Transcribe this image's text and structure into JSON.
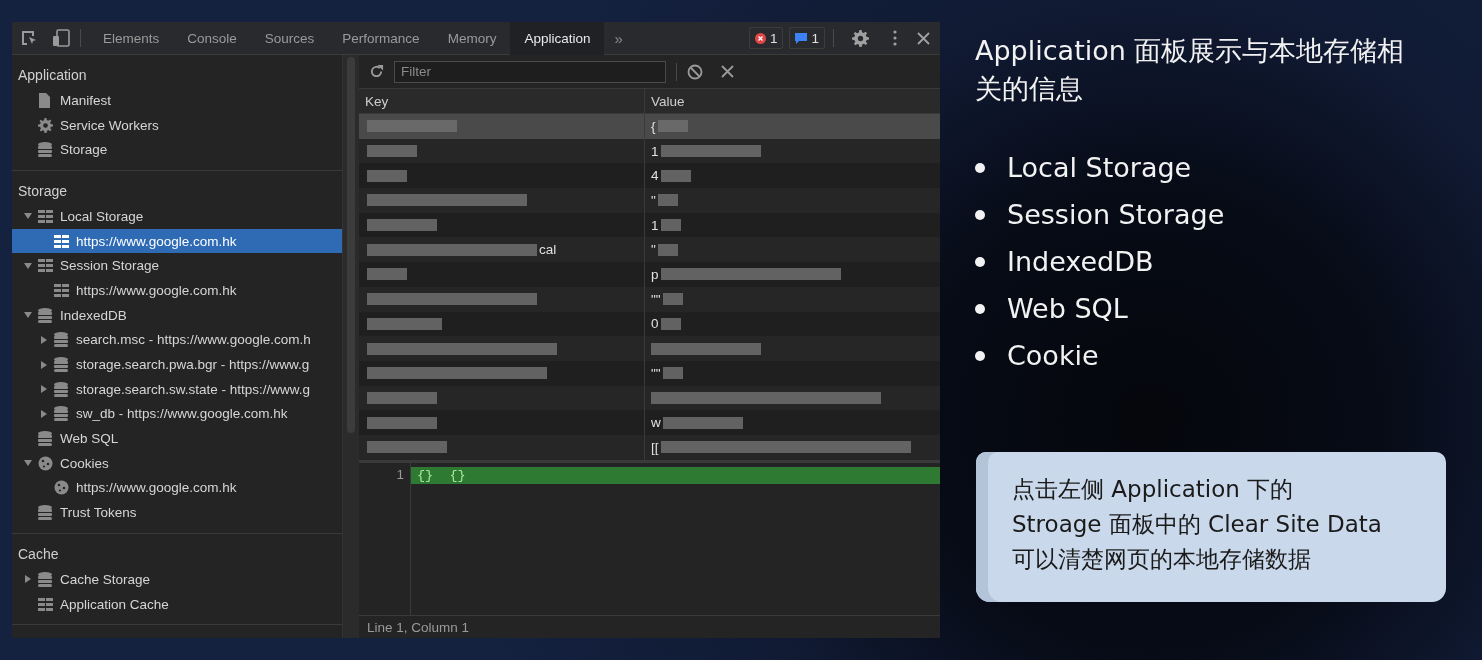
{
  "devtools": {
    "tabs": [
      {
        "label": "Elements",
        "selected": false
      },
      {
        "label": "Console",
        "selected": false
      },
      {
        "label": "Sources",
        "selected": false
      },
      {
        "label": "Performance",
        "selected": false
      },
      {
        "label": "Memory",
        "selected": false
      },
      {
        "label": "Application",
        "selected": true
      }
    ],
    "more_tabs": "»",
    "error_count": "1",
    "message_count": "1",
    "sidebar": [
      {
        "title": "Application",
        "items": [
          {
            "label": "Manifest",
            "kind": "file",
            "selected": false
          },
          {
            "label": "Service Workers",
            "kind": "gear",
            "selected": false
          },
          {
            "label": "Storage",
            "kind": "db",
            "selected": false
          }
        ]
      },
      {
        "title": "Storage",
        "items": [
          {
            "label": "Local Storage",
            "kind": "grid",
            "expanded": true,
            "selected": false,
            "children": [
              {
                "label": "https://www.google.com.hk",
                "kind": "grid",
                "selected": true
              }
            ]
          },
          {
            "label": "Session Storage",
            "kind": "grid",
            "expanded": true,
            "selected": false,
            "children": [
              {
                "label": "https://www.google.com.hk",
                "kind": "grid",
                "selected": false
              }
            ]
          },
          {
            "label": "IndexedDB",
            "kind": "db",
            "expanded": true,
            "selected": false,
            "children": [
              {
                "label": "search.msc - https://www.google.com.h",
                "kind": "db",
                "expanded": false,
                "selected": false
              },
              {
                "label": "storage.search.pwa.bgr - https://www.g",
                "kind": "db",
                "expanded": false,
                "selected": false
              },
              {
                "label": "storage.search.sw.state - https://www.g",
                "kind": "db",
                "expanded": false,
                "selected": false
              },
              {
                "label": "sw_db - https://www.google.com.hk",
                "kind": "db",
                "expanded": false,
                "selected": false
              }
            ]
          },
          {
            "label": "Web SQL",
            "kind": "db",
            "selected": false
          },
          {
            "label": "Cookies",
            "kind": "cookie",
            "expanded": true,
            "selected": false,
            "children": [
              {
                "label": "https://www.google.com.hk",
                "kind": "cookie",
                "selected": false
              }
            ]
          },
          {
            "label": "Trust Tokens",
            "kind": "db",
            "selected": false
          }
        ]
      },
      {
        "title": "Cache",
        "items": [
          {
            "label": "Cache Storage",
            "kind": "db",
            "expanded": false,
            "selected": false
          },
          {
            "label": "Application Cache",
            "kind": "grid",
            "selected": false
          }
        ]
      }
    ],
    "filter": {
      "placeholder": "Filter"
    },
    "columns": [
      "Key",
      "Value"
    ],
    "rows": [
      {
        "value": "{",
        "selected": true
      },
      {
        "value": "1",
        "selected": false
      },
      {
        "value": "4",
        "selected": false
      },
      {
        "value": "\"",
        "selected": false
      },
      {
        "value": "1",
        "selected": false
      },
      {
        "key": "cal",
        "value": "\"",
        "selected": false
      },
      {
        "value": "p",
        "selected": false
      },
      {
        "value": "\"\"",
        "selected": false
      },
      {
        "value": "0",
        "selected": false
      },
      {
        "selected": false
      },
      {
        "value": "\"\"",
        "selected": false
      },
      {
        "selected": false
      },
      {
        "value": "w",
        "selected": false
      },
      {
        "value": "[[",
        "selected": false
      }
    ],
    "editor": {
      "line_number": "1",
      "code": "{}  {}"
    },
    "status": "Line 1, Column 1"
  },
  "slide": {
    "title": "Application 面板展示与本地存储相关的信息",
    "bullets": [
      "Local Storage",
      "Session Storage",
      "IndexedDB",
      "Web SQL",
      "Cookie"
    ],
    "note": [
      "点击左侧 Application 下的",
      "Stroage 面板中的 Clear Site Data",
      "可以清楚网页的本地存储数据"
    ]
  }
}
